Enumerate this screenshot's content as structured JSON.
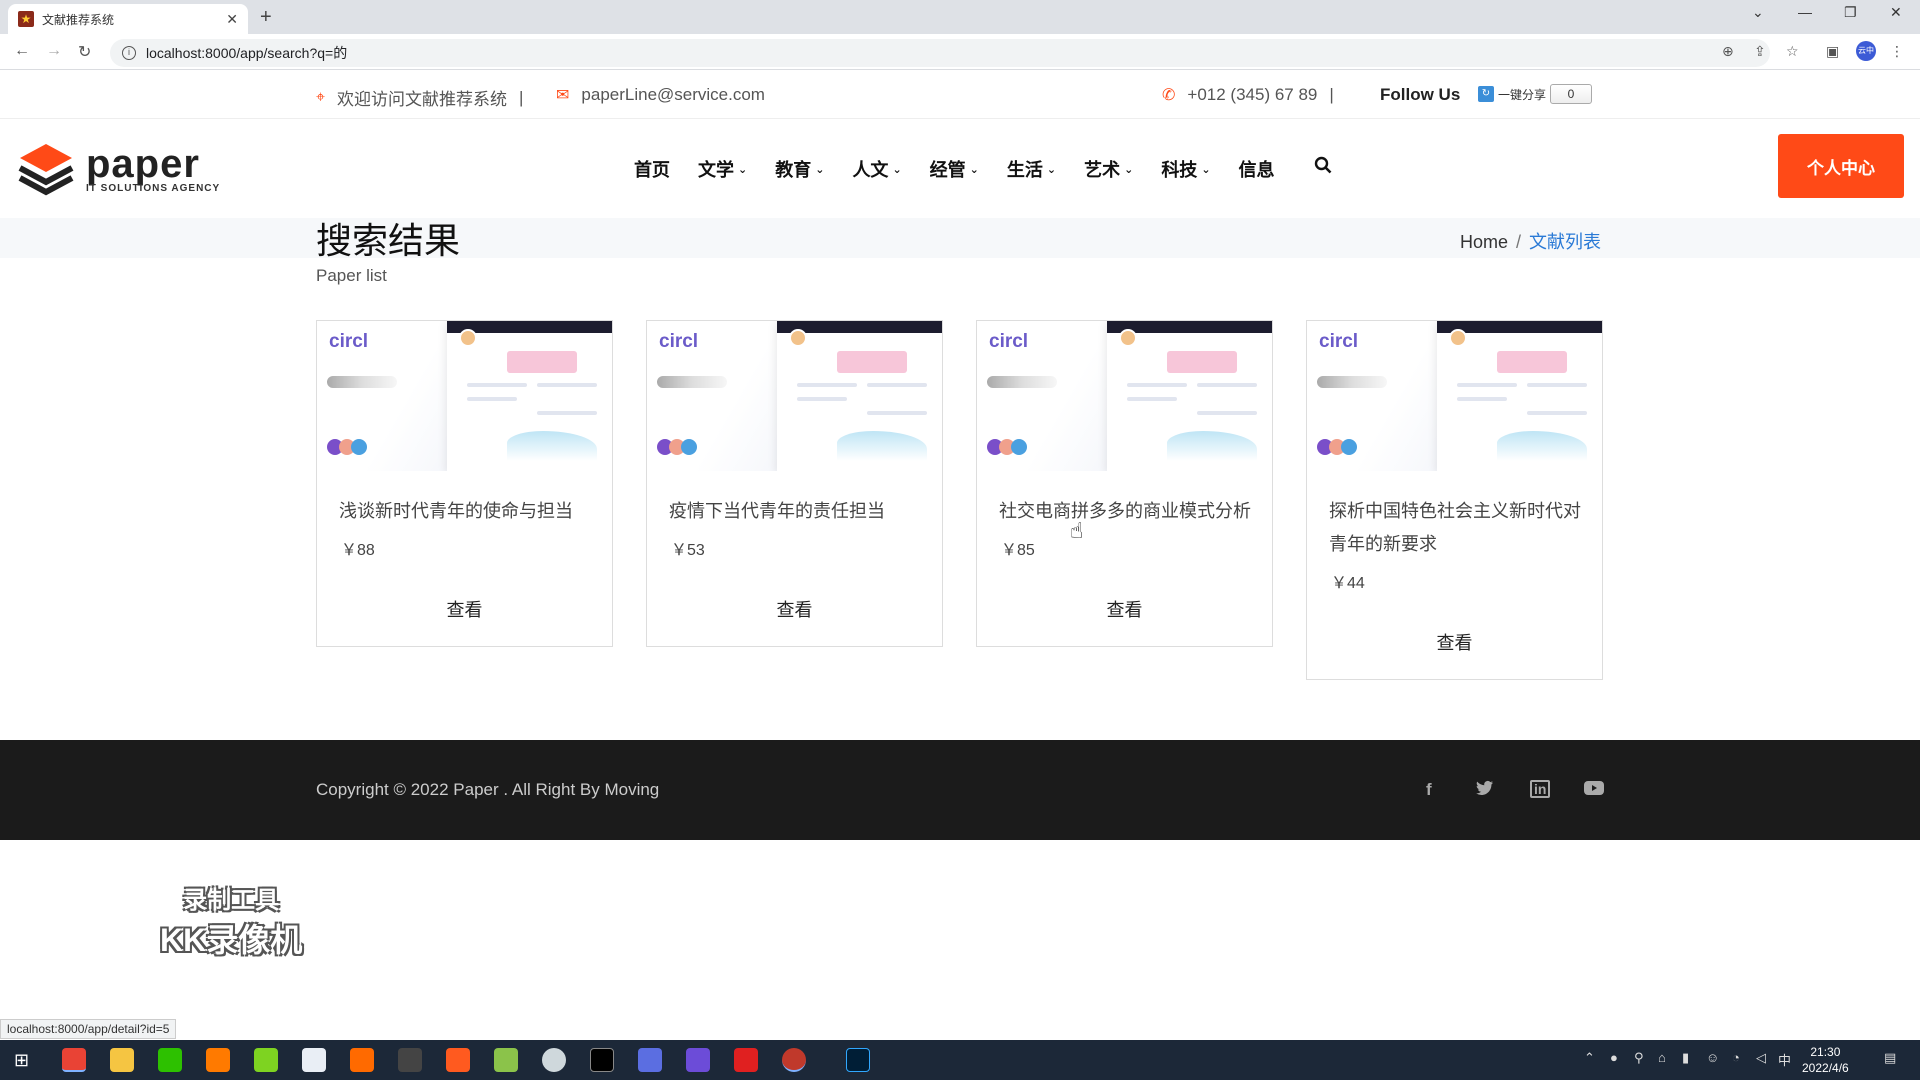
{
  "browser": {
    "tab_title": "文献推荐系统",
    "url": "localhost:8000/app/search?q=的",
    "status_url": "localhost:8000/app/detail?id=5"
  },
  "topbar": {
    "welcome": "欢迎访问文献推荐系统",
    "email": "paperLine@service.com",
    "phone": "+012 (345) 67 89",
    "follow": "Follow Us",
    "share_label": "一键分享",
    "share_count": "0",
    "sep": "|"
  },
  "header": {
    "logo_word": "paper",
    "logo_sub": "IT SOLUTIONS AGENCY",
    "nav": [
      {
        "label": "首页",
        "dropdown": false
      },
      {
        "label": "文学",
        "dropdown": true
      },
      {
        "label": "教育",
        "dropdown": true
      },
      {
        "label": "人文",
        "dropdown": true
      },
      {
        "label": "经管",
        "dropdown": true
      },
      {
        "label": "生活",
        "dropdown": true
      },
      {
        "label": "艺术",
        "dropdown": true
      },
      {
        "label": "科技",
        "dropdown": true
      },
      {
        "label": "信息",
        "dropdown": false
      }
    ],
    "user_center": "个人中心"
  },
  "page": {
    "title": "搜索结果",
    "subtitle": "Paper list",
    "breadcrumb_home": "Home",
    "breadcrumb_sep": "/",
    "breadcrumb_current": "文献列表"
  },
  "cards": [
    {
      "brand": "circl",
      "name": "浅谈新时代青年的使命与担当",
      "price": "￥88",
      "action": "查看"
    },
    {
      "brand": "circl",
      "name": "疫情下当代青年的责任担当",
      "price": "￥53",
      "action": "查看"
    },
    {
      "brand": "circl",
      "name": "社交电商拼多多的商业模式分析",
      "price": "￥85",
      "action": "查看"
    },
    {
      "brand": "circl",
      "name": "探析中国特色社会主义新时代对青年的新要求",
      "price": "￥44",
      "action": "查看"
    }
  ],
  "footer": {
    "copyright": "Copyright © 2022 Paper . All Right By Moving",
    "social": [
      "facebook-icon",
      "twitter-icon",
      "linkedin-icon",
      "youtube-icon"
    ]
  },
  "watermark": {
    "line1": "录制工具",
    "line2": "KK录像机"
  },
  "taskbar": {
    "time": "21:30",
    "date": "2022/4/6",
    "ime": "中"
  },
  "colors": {
    "accent": "#ff4a17",
    "link": "#2a7ad6",
    "footer_bg": "#1b1b1b"
  }
}
